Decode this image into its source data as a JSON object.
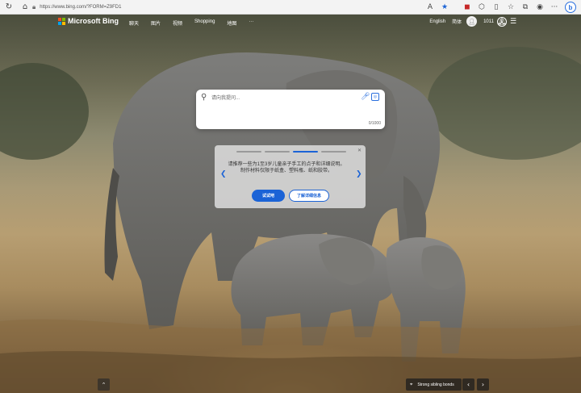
{
  "browser": {
    "url": "https://www.bing.com/?FORM=Z9FD1",
    "icons": [
      "refresh-icon",
      "home-icon",
      "lock-icon",
      "read-aloud-icon",
      "favorite-star-icon",
      "extension-shield-icon",
      "extension-icon",
      "split-screen-icon",
      "favorites-icon",
      "collections-icon",
      "profile-icon",
      "more-icon",
      "bing-copilot-icon"
    ]
  },
  "header": {
    "brand": "Microsoft Bing",
    "nav": [
      "聊天",
      "图片",
      "视频",
      "Shopping",
      "地图",
      "···"
    ],
    "language": "English",
    "region": "简体",
    "points": "1011"
  },
  "search": {
    "placeholder": "请向我提问...",
    "value": "",
    "counter": "0/1000"
  },
  "promo": {
    "message": "请推荐一些为1至3岁儿童亲子手工的点子和详细说明。制作材料仅限于纸盒、塑料瓶、纸和胶带。",
    "try_label": "试试吧",
    "learn_label": "了解详细信息",
    "steps": 4,
    "active_step": 3
  },
  "footer": {
    "caption": "Strong sibling bonds"
  },
  "colors": {
    "accent": "#1b63d6",
    "ms_red": "#f25022",
    "ms_green": "#7fba00",
    "ms_blue": "#00a4ef",
    "ms_yellow": "#ffb900"
  }
}
